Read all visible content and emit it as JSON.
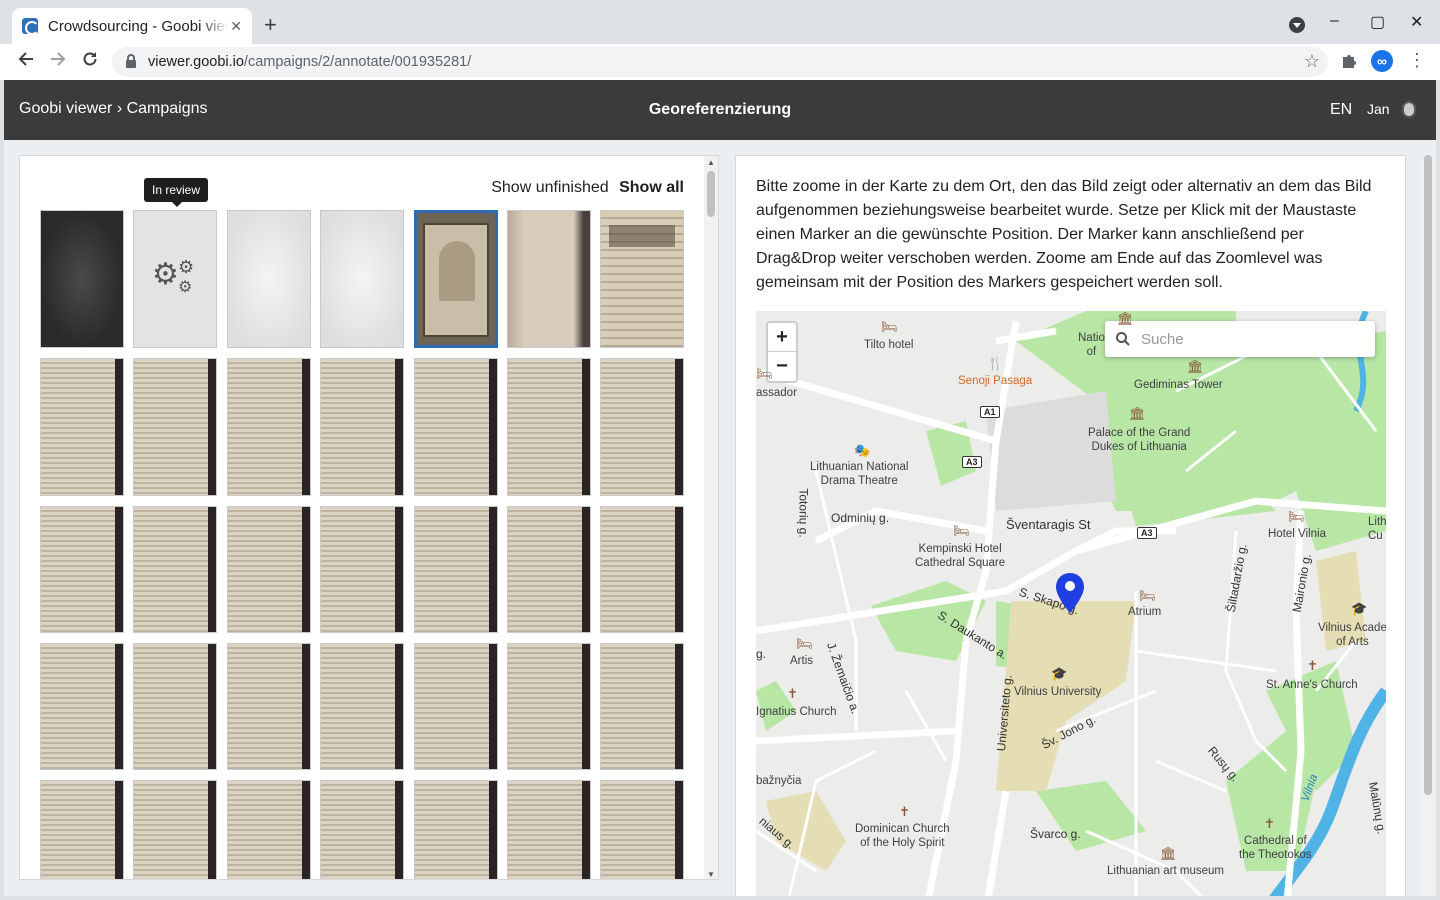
{
  "browser": {
    "tab_title": "Crowdsourcing - Goobi viewer",
    "tab_close": "✕",
    "new_tab": "+",
    "url_host": "viewer.goobi.io",
    "url_path": "/campaigns/2/annotate/001935281/",
    "window_controls": {
      "minimize": "–",
      "maximize": "▢",
      "close": "✕"
    }
  },
  "header": {
    "breadcrumb": "Goobi viewer › Campaigns",
    "title": "Georeferenzierung",
    "language": "EN",
    "user": "Jan"
  },
  "left_panel": {
    "tooltip": "In review",
    "filter_unfinished": "Show unfinished",
    "filter_all": "Show all",
    "selected_index": 4
  },
  "right_panel": {
    "instructions": "Bitte zoome in der Karte zu dem Ort, den das Bild zeigt oder alternativ an dem das Bild aufgenommen beziehungsweise bearbeitet wurde. Setze per Klick mit der Maustaste einen Marker an die gewünschte Position. Der Marker kann anschließend per Drag&Drop weiter verschoben werden. Zoome am Ende auf das Zoomlevel was gemeinsam mit der Position des Markers gespeichert werden soll.",
    "zoom_in": "+",
    "zoom_out": "−",
    "search_placeholder": "Suche",
    "labels": {
      "tilto": "Tilto hotel",
      "senoji": "Senoji Pasaga",
      "nation": "Natio\nof",
      "gediminas": "Gediminas Tower",
      "ambassador": "assador",
      "palace": "Palace of the Grand\nDukes of Lithuania",
      "theatre": "Lithuanian National\nDrama Theatre",
      "totoriu": "Totorių g.",
      "odminiu": "Odminių g.",
      "sventaragis": "Šventaragis St",
      "kempinski": "Kempinski Hotel\nCathedral Square",
      "hotel_vilnia": "Hotel Vilnia",
      "lith": "Lith\nCu",
      "skapo": "S. Skapo g.",
      "atrium": "Atrium",
      "siltadarzio": "Šiltadaržio g.",
      "maironio": "Maironio g.",
      "daukanto": "S. Daukanto a.",
      "academy": "Vilnius Acade\nof Arts",
      "artis": "Artis",
      "zemaicio": "J. Žemaičio a.",
      "university": "Vilnius University",
      "st_anne": "St. Anne's Church",
      "ignatius": "Ignatius Church",
      "universiteto": "Universiteto g.",
      "jono": "Šv. Jono g.",
      "rusu": "Rusų g.",
      "baznycia": "bažnyčia",
      "vilnia": "Vilnia",
      "maluno": "Malūnų g.",
      "dominican": "Dominican Church\nof the Holy Spirit",
      "svarco": "Švarco g.",
      "theotokos": "Cathedral of\nthe Theotokos",
      "art_museum": "Lithuanian art museum",
      "niaus": "niaus g.",
      "a1": "A1",
      "a3": "A3",
      "a3b": "A3",
      "g_left": "g."
    }
  },
  "thumbnails": {
    "rows": 5,
    "cols": 7,
    "row_types": [
      [
        "dark",
        "gears",
        "blank",
        "blank",
        "title",
        "plain",
        "title2"
      ],
      [
        "text",
        "text",
        "text",
        "text",
        "text",
        "text",
        "text"
      ],
      [
        "text",
        "text",
        "text",
        "text",
        "text",
        "text",
        "text"
      ],
      [
        "text",
        "text",
        "text",
        "text",
        "text",
        "text",
        "text"
      ],
      [
        "text",
        "text",
        "text",
        "text",
        "text",
        "text",
        "text"
      ]
    ]
  },
  "colors": {
    "header_bg": "#3b3b3b",
    "selected_border": "#2c6bb4",
    "marker": "#1f3fe3",
    "park": "#b7e6a5",
    "water": "#4fb3e6",
    "university": "#e5ddb3"
  },
  "icons": [
    "back-icon",
    "forward-icon",
    "reload-icon",
    "lock-icon",
    "star-icon",
    "puzzle-icon",
    "menu-icon",
    "search-icon",
    "map-marker-icon",
    "gears-icon"
  ]
}
